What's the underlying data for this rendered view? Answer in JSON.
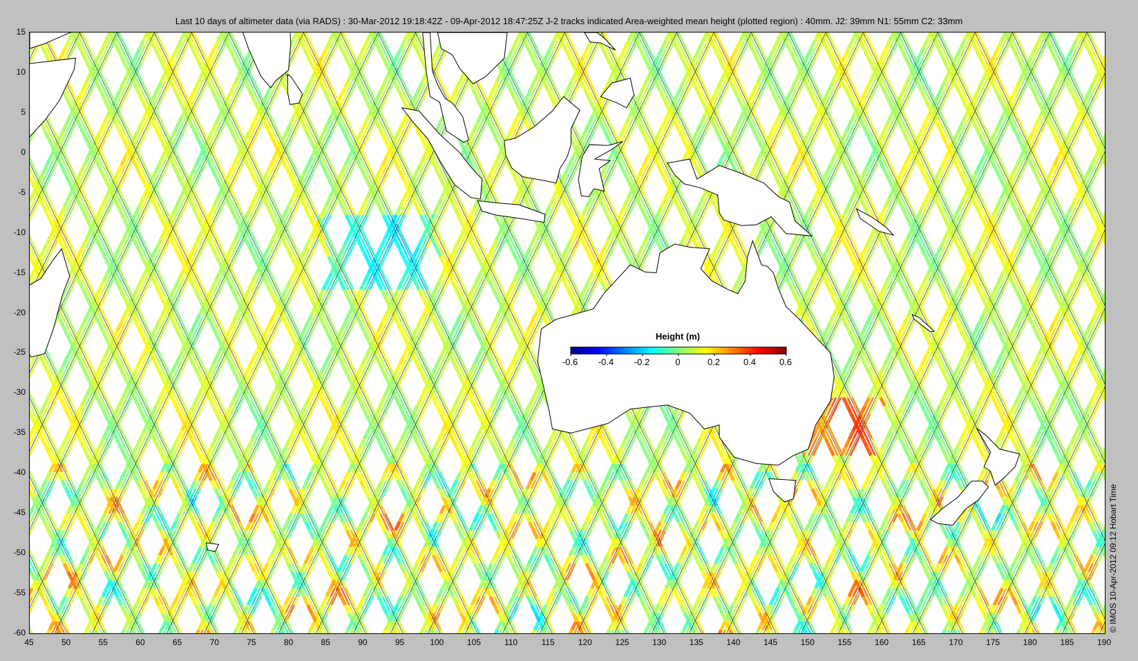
{
  "title": "Last 10 days of altimeter data (via RADS) : 30-Mar-2012 19:18:42Z - 09-Apr-2012 18:47:25Z  J-2 tracks indicated  Area-weighted mean height (plotted region) : 40mm.  J2: 39mm  N1: 55mm  C2: 33mm",
  "credit": "© IMOS 10-Apr-2012 09:12 Hobart Time",
  "map": {
    "lon_range": [
      45,
      190
    ],
    "lat_range": [
      -60,
      15
    ],
    "x_ticks": [
      "45",
      "50",
      "55",
      "60",
      "65",
      "70",
      "75",
      "80",
      "85",
      "90",
      "95",
      "100",
      "105",
      "110",
      "115",
      "120",
      "125",
      "130",
      "135",
      "140",
      "145",
      "150",
      "155",
      "160",
      "165",
      "170",
      "175",
      "180",
      "185",
      "190"
    ],
    "y_ticks": [
      "15",
      "10",
      "5",
      "0",
      "-5",
      "-10",
      "-15",
      "-20",
      "-25",
      "-30",
      "-35",
      "-40",
      "-45",
      "-50",
      "-55",
      "-60"
    ]
  },
  "colorbar": {
    "title": "Height (m)",
    "range": [
      -0.6,
      0.6
    ],
    "ticks": [
      "-0.6",
      "-0.4",
      "-0.2",
      "0",
      "0.2",
      "0.4",
      "0.6"
    ],
    "colors": [
      "#00008f",
      "#0000ff",
      "#0080ff",
      "#00ffff",
      "#80ff80",
      "#ffff00",
      "#ff8000",
      "#ff0000",
      "#800000"
    ]
  },
  "colors": {
    "background": "#c0c0c0",
    "land": "#ffffff",
    "coast": "#000000",
    "track_line": "#1a1a4a"
  }
}
